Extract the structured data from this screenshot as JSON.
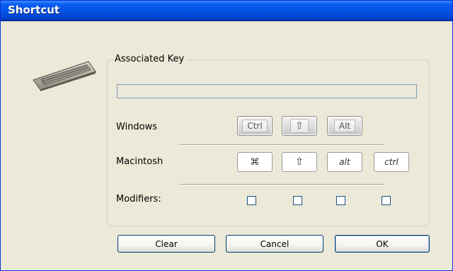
{
  "window": {
    "title": "Shortcut"
  },
  "group": {
    "label": "Associated Key",
    "key_value": ""
  },
  "rows": {
    "windows": {
      "label": "Windows",
      "keys": [
        "Ctrl",
        "⇧",
        "Alt"
      ]
    },
    "macintosh": {
      "label": "Macintosh",
      "keys": [
        "⌘",
        "⇧",
        "alt",
        "ctrl"
      ]
    },
    "modifiers": {
      "label": "Modifiers:",
      "checked": [
        false,
        false,
        false,
        false
      ]
    }
  },
  "buttons": {
    "clear": "Clear",
    "cancel": "Cancel",
    "ok": "OK"
  },
  "icons": {
    "header": "keyboard-icon"
  }
}
